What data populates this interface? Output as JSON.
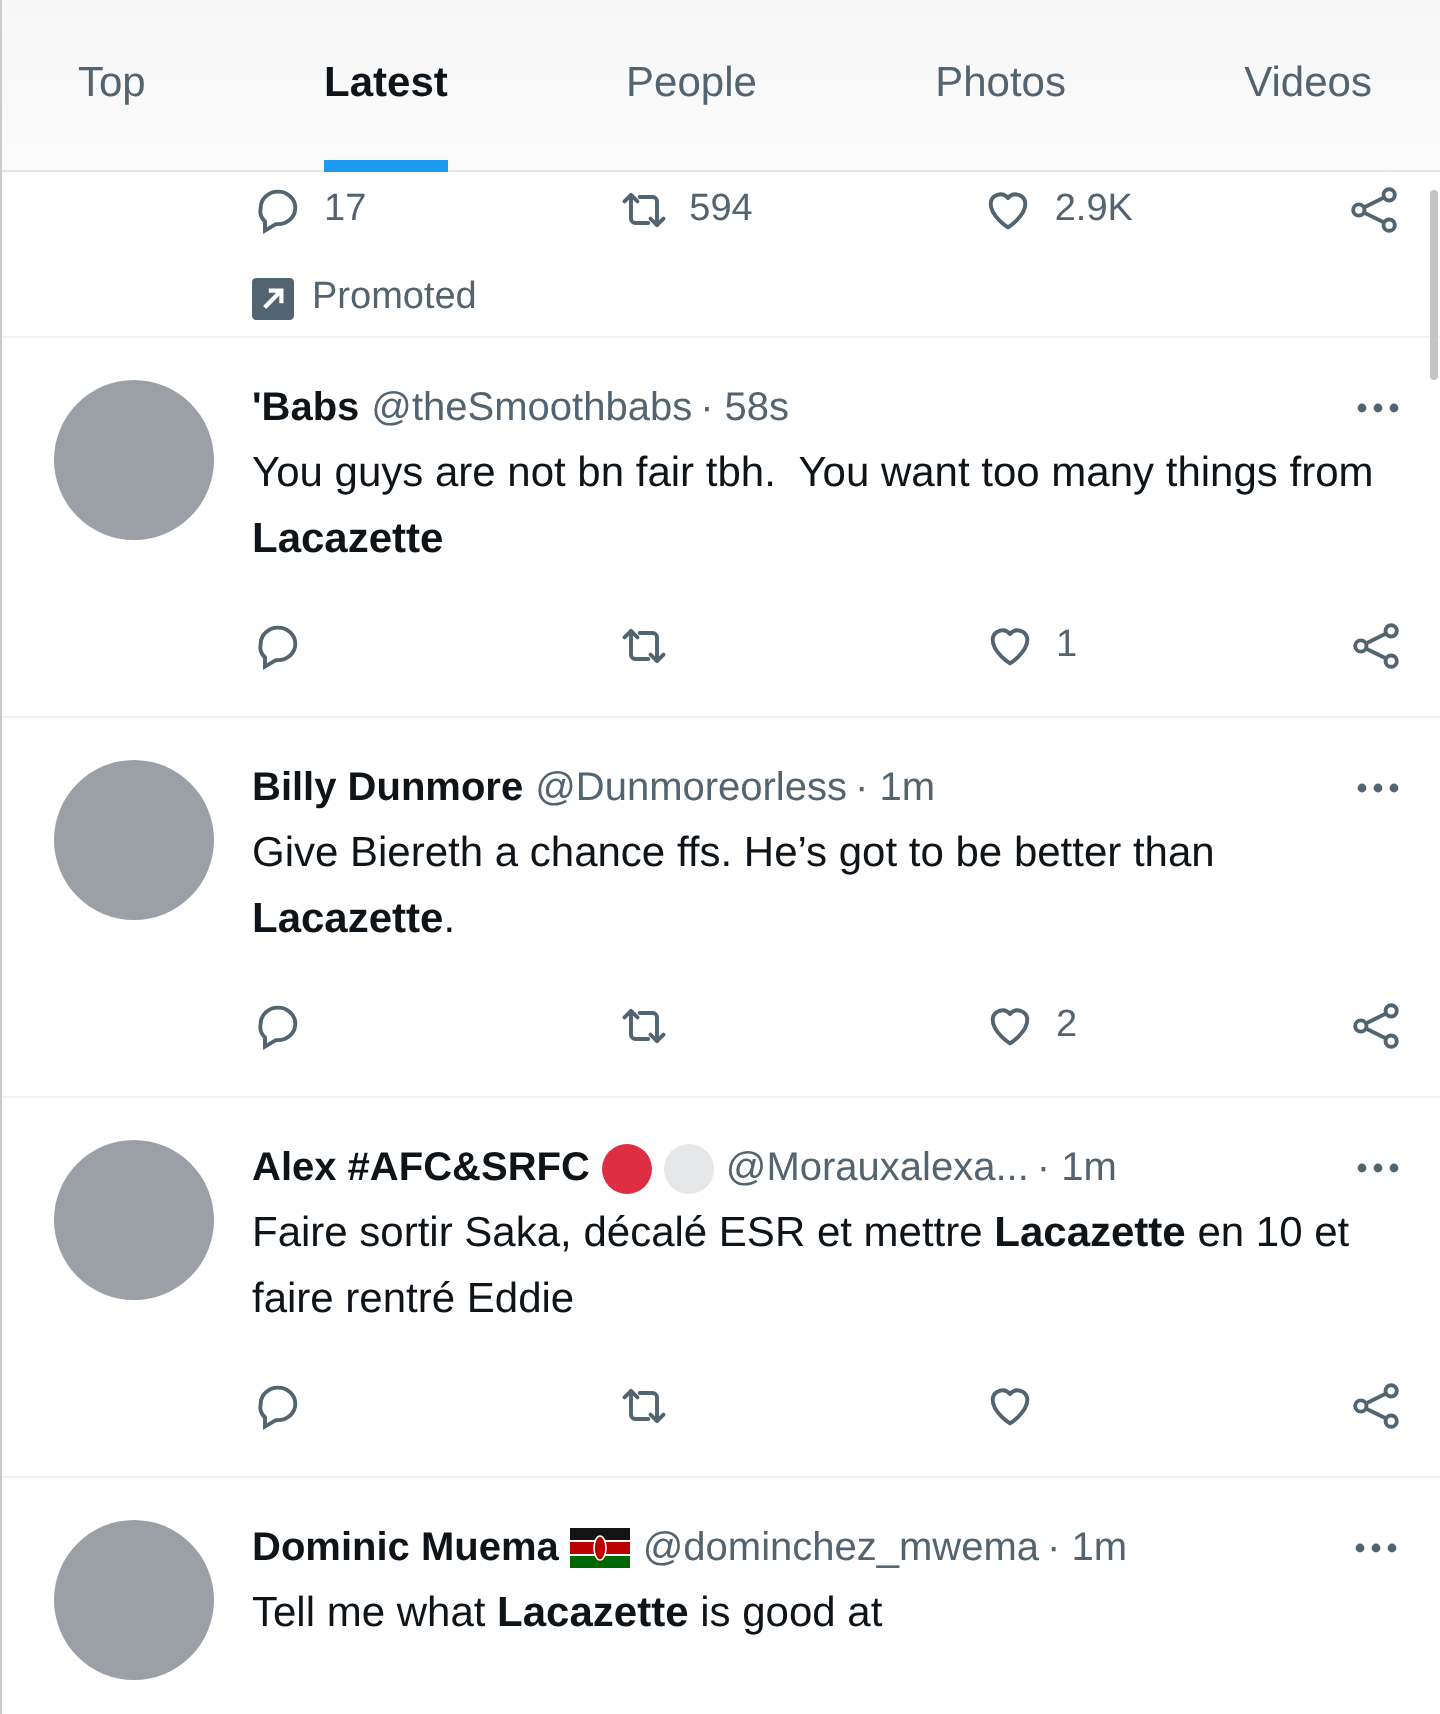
{
  "tabs": [
    {
      "label": "Top",
      "selected": false
    },
    {
      "label": "Latest",
      "selected": true
    },
    {
      "label": "People",
      "selected": false
    },
    {
      "label": "Photos",
      "selected": false
    },
    {
      "label": "Videos",
      "selected": false
    }
  ],
  "promoted_tweet": {
    "actions": [
      {
        "kind": "reply",
        "count": "17"
      },
      {
        "kind": "retweet",
        "count": "594"
      },
      {
        "kind": "like",
        "count": "2.9K"
      },
      {
        "kind": "share"
      }
    ],
    "promoted_label": "Promoted"
  },
  "tweets": [
    {
      "name": "'Babs",
      "handle": "@theSmoothbabs",
      "time": "· 58s",
      "text": "You guys are not bn fair tbh.  You want too many things from **Lacazette**",
      "actions": [
        {
          "kind": "reply"
        },
        {
          "kind": "retweet"
        },
        {
          "kind": "like",
          "count": "1"
        },
        {
          "kind": "share"
        }
      ]
    },
    {
      "name": "Billy Dunmore",
      "handle": "@Dunmoreorless",
      "time": "· 1m",
      "text": "Give Biereth a chance ffs. He’s got to be better than **Lacazette**.",
      "actions": [
        {
          "kind": "reply"
        },
        {
          "kind": "retweet"
        },
        {
          "kind": "like",
          "count": "2"
        },
        {
          "kind": "share"
        }
      ]
    },
    {
      "name": "Alex #AFC&SRFC",
      "badges": [
        {
          "kind": "red-circle"
        },
        {
          "kind": "white-circle"
        }
      ],
      "handle": "@Morauxalexa...",
      "time": "· 1m",
      "text": "Faire sortir Saka, décalé ESR et mettre **Lacazette** en 10 et faire rentré Eddie",
      "actions": [
        {
          "kind": "reply"
        },
        {
          "kind": "retweet"
        },
        {
          "kind": "like"
        },
        {
          "kind": "share"
        }
      ]
    },
    {
      "name": "Dominic Muema",
      "badges": [
        {
          "kind": "flag"
        }
      ],
      "handle": "@dominchez_mwema",
      "time": "· 1m",
      "text": "Tell me what **Lacazette** is good at"
    }
  ]
}
